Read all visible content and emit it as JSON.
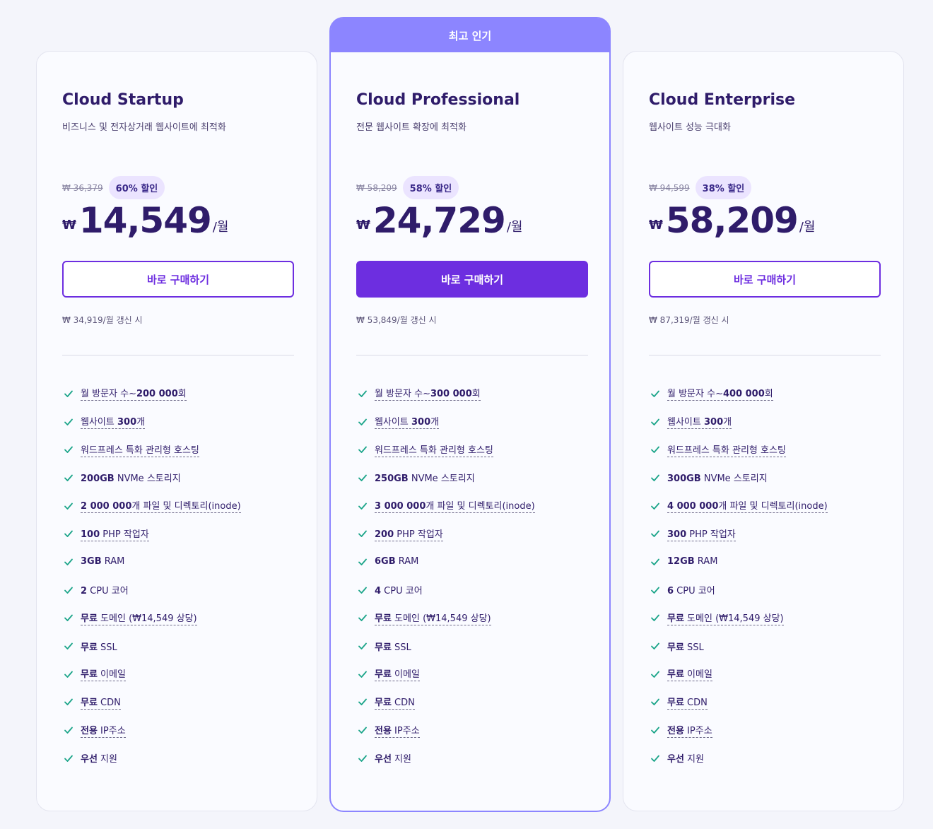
{
  "colors": {
    "accent": "#6d2ee0",
    "ribbon": "#8c85ff",
    "check": "#19a488",
    "text": "#2f1c6a"
  },
  "plans": [
    {
      "name": "Cloud Startup",
      "subtitle": "비즈니스 및 전자상거래 웹사이트에 최적화",
      "old_price": "₩ 36,379",
      "discount": "60% 할인",
      "currency": "₩",
      "price": "14,549",
      "per": "/월",
      "button": "바로 구매하기",
      "renew": "₩ 34,919/월 갱신 시",
      "features": [
        {
          "bold": "",
          "text": "월 방문자 수~",
          "bold2": "200 000",
          "tail": "회",
          "underline": true
        },
        {
          "bold": "",
          "text": "웹사이트 ",
          "bold2": "300",
          "tail": "개",
          "underline": true
        },
        {
          "bold": "",
          "text": "워드프레스 특화 관리형 호스팅",
          "bold2": "",
          "tail": "",
          "underline": true
        },
        {
          "bold": "200GB",
          "text": " NVMe 스토리지",
          "bold2": "",
          "tail": "",
          "underline": false
        },
        {
          "bold": "2 000 000",
          "text": "개 파일 및 디렉토리(inode)",
          "bold2": "",
          "tail": "",
          "underline": true
        },
        {
          "bold": "100",
          "text": " PHP 작업자",
          "bold2": "",
          "tail": "",
          "underline": true
        },
        {
          "bold": "3GB",
          "text": " RAM",
          "bold2": "",
          "tail": "",
          "underline": false
        },
        {
          "bold": "2",
          "text": " CPU 코어",
          "bold2": "",
          "tail": "",
          "underline": false
        },
        {
          "bold": "무료",
          "text": " 도메인 (₩14,549 상당)",
          "bold2": "",
          "tail": "",
          "underline": true
        },
        {
          "bold": "무료",
          "text": " SSL",
          "bold2": "",
          "tail": "",
          "underline": false
        },
        {
          "bold": "무료",
          "text": " 이메일",
          "bold2": "",
          "tail": "",
          "underline": true
        },
        {
          "bold": "무료",
          "text": " CDN",
          "bold2": "",
          "tail": "",
          "underline": true
        },
        {
          "bold": "전용",
          "text": " IP주소",
          "bold2": "",
          "tail": "",
          "underline": true
        },
        {
          "bold": "우선",
          "text": " 지원",
          "bold2": "",
          "tail": "",
          "underline": false
        }
      ]
    },
    {
      "ribbon": "최고 인기",
      "name": "Cloud Professional",
      "subtitle": "전문 웹사이트 확장에 최적화",
      "old_price": "₩ 58,209",
      "discount": "58% 할인",
      "currency": "₩",
      "price": "24,729",
      "per": "/월",
      "button": "바로 구매하기",
      "renew": "₩ 53,849/월 갱신 시",
      "features": [
        {
          "bold": "",
          "text": "월 방문자 수~",
          "bold2": "300 000",
          "tail": "회",
          "underline": true
        },
        {
          "bold": "",
          "text": "웹사이트 ",
          "bold2": "300",
          "tail": "개",
          "underline": true
        },
        {
          "bold": "",
          "text": "워드프레스 특화 관리형 호스팅",
          "bold2": "",
          "tail": "",
          "underline": true
        },
        {
          "bold": "250GB",
          "text": " NVMe 스토리지",
          "bold2": "",
          "tail": "",
          "underline": false
        },
        {
          "bold": "3 000 000",
          "text": "개 파일 및 디렉토리(inode)",
          "bold2": "",
          "tail": "",
          "underline": true
        },
        {
          "bold": "200",
          "text": " PHP 작업자",
          "bold2": "",
          "tail": "",
          "underline": true
        },
        {
          "bold": "6GB",
          "text": " RAM",
          "bold2": "",
          "tail": "",
          "underline": false
        },
        {
          "bold": "4",
          "text": " CPU 코어",
          "bold2": "",
          "tail": "",
          "underline": false
        },
        {
          "bold": "무료",
          "text": " 도메인 (₩14,549 상당)",
          "bold2": "",
          "tail": "",
          "underline": true
        },
        {
          "bold": "무료",
          "text": " SSL",
          "bold2": "",
          "tail": "",
          "underline": false
        },
        {
          "bold": "무료",
          "text": " 이메일",
          "bold2": "",
          "tail": "",
          "underline": true
        },
        {
          "bold": "무료",
          "text": " CDN",
          "bold2": "",
          "tail": "",
          "underline": true
        },
        {
          "bold": "전용",
          "text": " IP주소",
          "bold2": "",
          "tail": "",
          "underline": true
        },
        {
          "bold": "우선",
          "text": " 지원",
          "bold2": "",
          "tail": "",
          "underline": false
        }
      ]
    },
    {
      "name": "Cloud Enterprise",
      "subtitle": "웹사이트 성능 극대화",
      "old_price": "₩ 94,599",
      "discount": "38% 할인",
      "currency": "₩",
      "price": "58,209",
      "per": "/월",
      "button": "바로 구매하기",
      "renew": "₩ 87,319/월 갱신 시",
      "features": [
        {
          "bold": "",
          "text": "월 방문자 수~",
          "bold2": "400 000",
          "tail": "회",
          "underline": true
        },
        {
          "bold": "",
          "text": "웹사이트 ",
          "bold2": "300",
          "tail": "개",
          "underline": true
        },
        {
          "bold": "",
          "text": "워드프레스 특화 관리형 호스팅",
          "bold2": "",
          "tail": "",
          "underline": true
        },
        {
          "bold": "300GB",
          "text": " NVMe 스토리지",
          "bold2": "",
          "tail": "",
          "underline": false
        },
        {
          "bold": "4 000 000",
          "text": "개 파일 및 디렉토리(inode)",
          "bold2": "",
          "tail": "",
          "underline": true
        },
        {
          "bold": "300",
          "text": " PHP 작업자",
          "bold2": "",
          "tail": "",
          "underline": true
        },
        {
          "bold": "12GB",
          "text": " RAM",
          "bold2": "",
          "tail": "",
          "underline": false
        },
        {
          "bold": "6",
          "text": " CPU 코어",
          "bold2": "",
          "tail": "",
          "underline": false
        },
        {
          "bold": "무료",
          "text": " 도메인 (₩14,549 상당)",
          "bold2": "",
          "tail": "",
          "underline": true
        },
        {
          "bold": "무료",
          "text": " SSL",
          "bold2": "",
          "tail": "",
          "underline": false
        },
        {
          "bold": "무료",
          "text": " 이메일",
          "bold2": "",
          "tail": "",
          "underline": true
        },
        {
          "bold": "무료",
          "text": " CDN",
          "bold2": "",
          "tail": "",
          "underline": true
        },
        {
          "bold": "전용",
          "text": " IP주소",
          "bold2": "",
          "tail": "",
          "underline": true
        },
        {
          "bold": "우선",
          "text": " 지원",
          "bold2": "",
          "tail": "",
          "underline": false
        }
      ]
    }
  ]
}
